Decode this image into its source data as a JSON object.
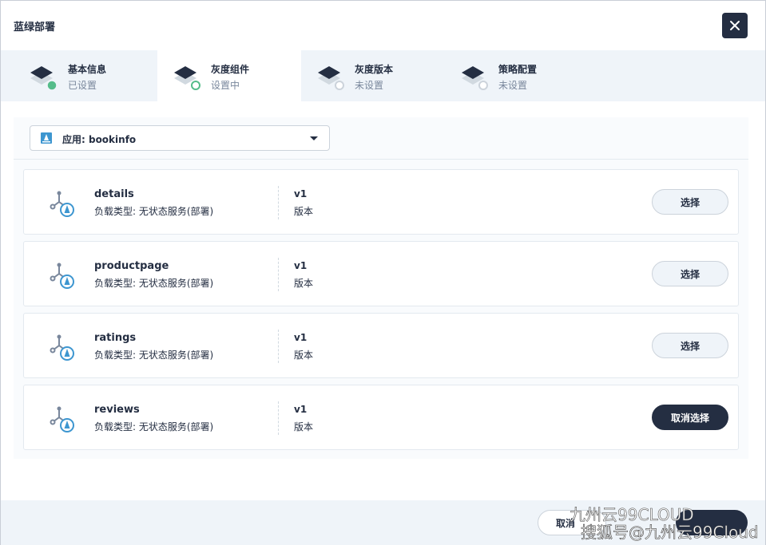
{
  "dialog": {
    "title": "蓝绿部署",
    "close_icon": "close-icon"
  },
  "steps": [
    {
      "label": "基本信息",
      "status": "已设置",
      "state": "done"
    },
    {
      "label": "灰度组件",
      "status": "设置中",
      "state": "active"
    },
    {
      "label": "灰度版本",
      "status": "未设置",
      "state": "pending"
    },
    {
      "label": "策略配置",
      "status": "未设置",
      "state": "pending"
    }
  ],
  "app_select": {
    "label": "应用: bookinfo",
    "icon": "app-icon"
  },
  "services": [
    {
      "name": "details",
      "type": "负载类型: 无状态服务(部署)",
      "version": "v1",
      "version_label": "版本",
      "button": "选择",
      "selected": false
    },
    {
      "name": "productpage",
      "type": "负载类型: 无状态服务(部署)",
      "version": "v1",
      "version_label": "版本",
      "button": "选择",
      "selected": false
    },
    {
      "name": "ratings",
      "type": "负载类型: 无状态服务(部署)",
      "version": "v1",
      "version_label": "版本",
      "button": "选择",
      "selected": false
    },
    {
      "name": "reviews",
      "type": "负载类型: 无状态服务(部署)",
      "version": "v1",
      "version_label": "版本",
      "button": "取消选择",
      "selected": true
    }
  ],
  "footer": {
    "cancel_label": "取消"
  },
  "watermark": {
    "line1": "九州云99CLOUD",
    "line2": "搜狐号@九州云99Cloud"
  },
  "colors": {
    "primary_dark": "#242e42",
    "done_green": "#55bc8a",
    "panel_bg": "#eff4f9",
    "icon_blue": "#3d96d0"
  }
}
